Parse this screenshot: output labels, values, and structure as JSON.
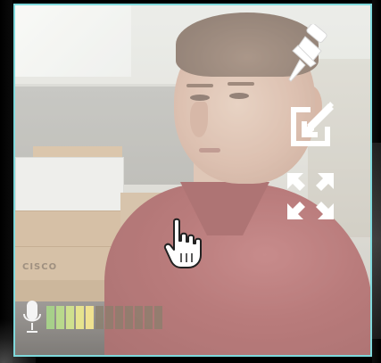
{
  "video_preview": {
    "border_color": "#7fd9dc",
    "box_label": "CISCO"
  },
  "controls": {
    "pin_icon": "pin-icon",
    "popout_icon": "pop-in-arrow-icon",
    "fullscreen_icon": "fullscreen-expand-icon"
  },
  "cursor": {
    "icon": "hand-pointer-cursor-icon"
  },
  "microphone": {
    "icon": "microphone-icon",
    "level_segments_total": 12,
    "level_segments_active": 5,
    "active_colors": [
      "#a7d08a",
      "#b9d98c",
      "#cfe08e",
      "#e6e38e",
      "#efe190"
    ],
    "inactive_color": "#8a7f6c"
  }
}
